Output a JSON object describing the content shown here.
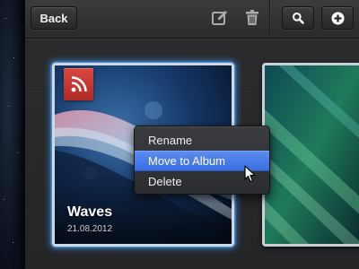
{
  "toolbar": {
    "back_label": "Back",
    "icons": {
      "edit": "edit-icon",
      "trash": "trash-icon",
      "search": "search-icon",
      "add": "add-circle-icon"
    }
  },
  "albums": [
    {
      "title": "Waves",
      "date": "21.08.2012",
      "badge_icon": "rss-icon",
      "selected": true
    },
    {
      "title": "",
      "date": ""
    }
  ],
  "context_menu": {
    "items": [
      {
        "label": "Rename",
        "selected": false
      },
      {
        "label": "Move to Album",
        "selected": true
      },
      {
        "label": "Delete",
        "selected": false
      }
    ]
  },
  "colors": {
    "selection_glow": "#4aa8ff",
    "menu_highlight": "#3a6ee0",
    "badge_red": "#c4352f"
  }
}
